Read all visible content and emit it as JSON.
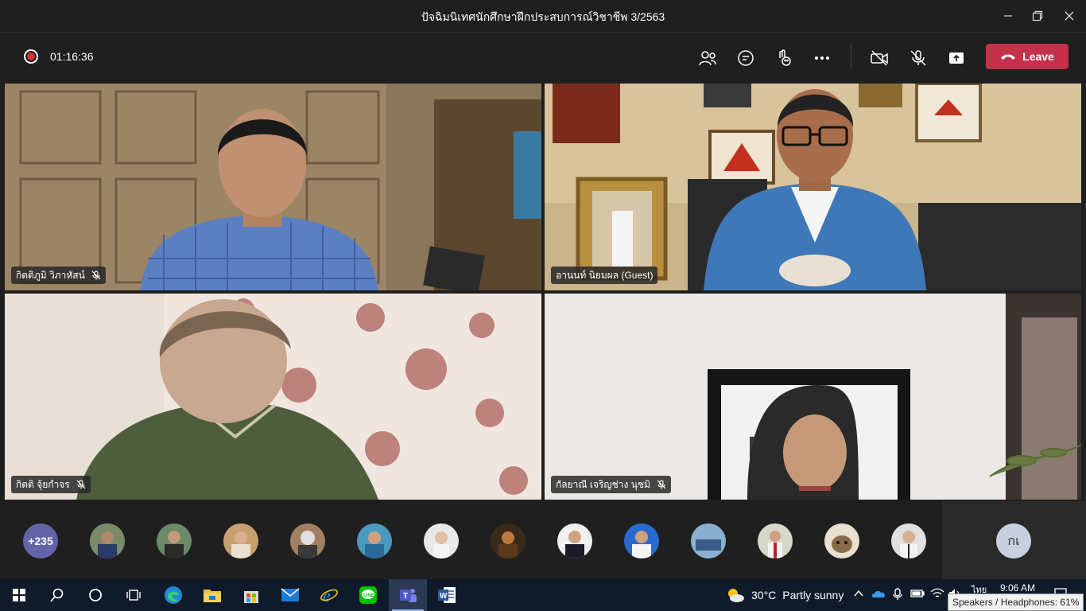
{
  "window": {
    "title": "ปัจฉิมนิเทศนักศึกษาฝึกประสบการณ์วิชาชีพ 3/2563"
  },
  "meeting": {
    "timer": "01:16:36",
    "leave_label": "Leave",
    "accent": "#c4314b"
  },
  "participants": [
    {
      "name": "กิตติภูมิ วิภาหัสน์",
      "muted": true
    },
    {
      "name": "อานนท์ นิยมผล (Guest)",
      "muted": false
    },
    {
      "name": "กิตติ จุ้ยกำจร",
      "muted": true
    },
    {
      "name": "กัลยาณี เจริญช่าง นุชมิ",
      "muted": true
    }
  ],
  "strip": {
    "overflow_count": "+235",
    "self_initials": "กเ"
  },
  "taskbar": {
    "weather_temp": "30°C",
    "weather_desc": "Partly sunny",
    "time": "9:06 AM",
    "lang": "ไทย",
    "tooltip": "Speakers / Headphones: 61%"
  }
}
